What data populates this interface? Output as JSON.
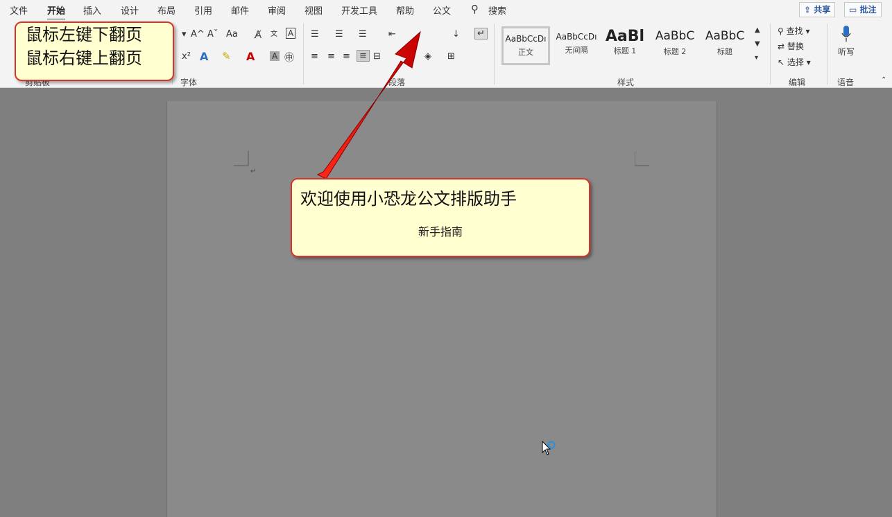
{
  "menu": {
    "tabs": [
      "文件",
      "开始",
      "插入",
      "设计",
      "布局",
      "引用",
      "邮件",
      "审阅",
      "视图",
      "开发工具",
      "帮助",
      "公文"
    ],
    "search": "搜索",
    "share": "共享",
    "comment": "批注"
  },
  "ribbon": {
    "groups": {
      "clipboard": "剪贴板",
      "font": "字体",
      "paragraph": "段落",
      "styles": "样式",
      "editing": "编辑",
      "voice": "语音"
    },
    "styles": [
      {
        "sample": "AaBbCcDı",
        "name": "正文"
      },
      {
        "sample": "AaBbCcDı",
        "name": "无间隔"
      },
      {
        "sample": "AaBl",
        "name": "标题 1"
      },
      {
        "sample": "AaBbC",
        "name": "标题 2"
      },
      {
        "sample": "AaBbC",
        "name": "标题"
      }
    ],
    "editing": {
      "find": "查找",
      "replace": "替换",
      "select": "选择"
    },
    "voice": {
      "dictate": "听写"
    },
    "font_tools": {
      "grow": "A^",
      "shrink": "Aˇ",
      "case": "Aa",
      "sup": "x²"
    }
  },
  "callouts": {
    "nav_hint": [
      "鼠标左键下翻页",
      "鼠标右键上翻页"
    ],
    "welcome_title": "欢迎使用小恐龙公文排版助手",
    "welcome_sub": "新手指南"
  },
  "colors": {
    "accent": "#d9342b",
    "callout_bg": "#ffffcf",
    "ribbon": "#f3f3f3"
  }
}
